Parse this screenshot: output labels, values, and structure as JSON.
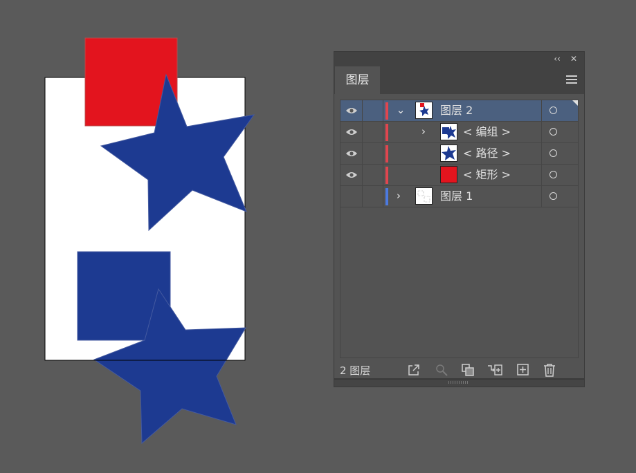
{
  "colors": {
    "canvas_bg": "#5a5a5a",
    "panel_bg": "#535353",
    "selected_row": "#4b607f",
    "layer2_color": "#e0464f",
    "layer1_color": "#4c7ae0",
    "red_shape": "#e3141e",
    "blue_shape": "#1d3a91"
  },
  "artboard": {
    "shapes": [
      "red-rectangle",
      "blue-star-top",
      "blue-square",
      "blue-star-bottom"
    ]
  },
  "panel": {
    "collapse_icon": "double-chevron-left-icon",
    "close_label": "✕",
    "collapse_label": "‹‹",
    "tab_label": "图层",
    "menu_icon": "hamburger-menu-icon",
    "rows": [
      {
        "label": "图层 2",
        "visible": true,
        "expanded": true,
        "selected": true
      },
      {
        "label": "< 编组 >",
        "visible": true,
        "expanded": false
      },
      {
        "label": "< 路径 >",
        "visible": true
      },
      {
        "label": "< 矩形 >",
        "visible": true
      },
      {
        "label": "图层 1",
        "visible": false,
        "expanded": false
      }
    ],
    "footer": {
      "count_label": "2 图层",
      "buttons": [
        "export-icon",
        "locate-object-icon",
        "make-clipping-mask-icon",
        "create-sublayer-icon",
        "new-layer-icon",
        "delete-icon"
      ]
    }
  }
}
